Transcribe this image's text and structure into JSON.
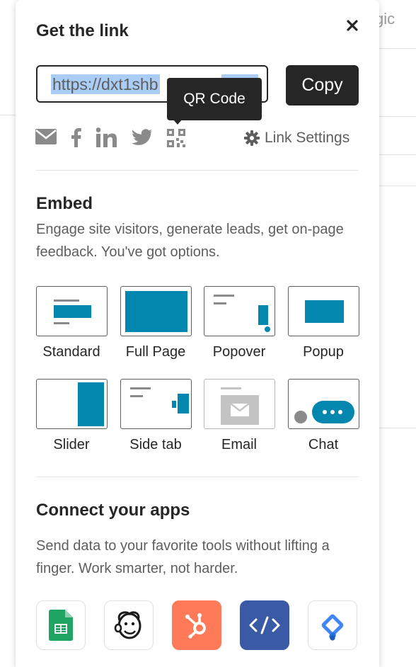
{
  "background": {
    "partial_text": "gic"
  },
  "popover": {
    "title": "Get the link",
    "close_icon": "close-icon",
    "link": {
      "url": "https://dxt1shb",
      "copy_label": "Copy"
    },
    "tooltip": "QR Code",
    "share_icons": [
      "email-icon",
      "facebook-icon",
      "linkedin-icon",
      "twitter-icon",
      "qr-code-icon"
    ],
    "link_settings_label": "Link Settings",
    "embed": {
      "title": "Embed",
      "description": "Engage site visitors, generate leads, get on-page feedback. You've got options.",
      "options": [
        {
          "label": "Standard"
        },
        {
          "label": "Full Page"
        },
        {
          "label": "Popover"
        },
        {
          "label": "Popup"
        },
        {
          "label": "Slider"
        },
        {
          "label": "Side tab"
        },
        {
          "label": "Email"
        },
        {
          "label": "Chat"
        }
      ]
    },
    "apps": {
      "title": "Connect your apps",
      "description": "Send data to your favorite tools without lifting a finger. Work smarter, not harder.",
      "items": [
        {
          "icon": "google-sheets-icon"
        },
        {
          "icon": "mailchimp-icon"
        },
        {
          "icon": "hubspot-icon"
        },
        {
          "icon": "code-icon"
        },
        {
          "icon": "google-tag-manager-icon"
        }
      ]
    },
    "colors": {
      "accent": "#0487af",
      "dark": "#262627",
      "hubspot": "#ff7a59",
      "code": "#3a5aa5",
      "sheets": "#1fa463",
      "gtm": "#4285f4"
    }
  }
}
